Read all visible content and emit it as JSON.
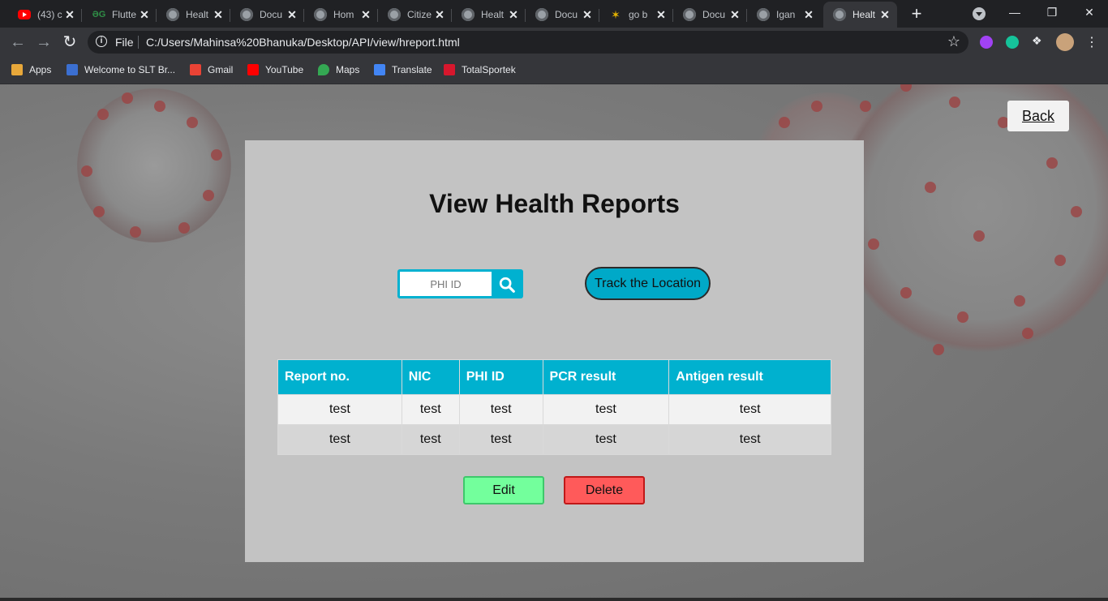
{
  "browser": {
    "tabs": [
      {
        "title": "(43) c",
        "icon": "youtube-icon",
        "active": false
      },
      {
        "title": "Flutte",
        "icon": "geeksforgeeks-icon",
        "active": false
      },
      {
        "title": "Healt",
        "icon": "globe-icon",
        "active": false
      },
      {
        "title": "Docu",
        "icon": "globe-icon",
        "active": false
      },
      {
        "title": "Hom",
        "icon": "globe-icon",
        "active": false
      },
      {
        "title": "Citize",
        "icon": "globe-icon",
        "active": false
      },
      {
        "title": "Healt",
        "icon": "globe-icon",
        "active": false
      },
      {
        "title": "Docu",
        "icon": "globe-icon",
        "active": false
      },
      {
        "title": "go b",
        "icon": "spark-icon",
        "active": false
      },
      {
        "title": "Docu",
        "icon": "globe-icon",
        "active": false
      },
      {
        "title": "Igan",
        "icon": "globe-icon",
        "active": false
      },
      {
        "title": "Healt",
        "icon": "globe-icon",
        "active": true
      }
    ],
    "new_tab_symbol": "+",
    "address": {
      "scheme_label": "File",
      "url": "C:/Users/Mahinsa%20Bhanuka/Desktop/API/view/hreport.html"
    },
    "bookmarks": [
      {
        "label": "Apps",
        "icon": "apps-grid-icon"
      },
      {
        "label": "Welcome to SLT Br...",
        "icon": "slt-icon"
      },
      {
        "label": "Gmail",
        "icon": "gmail-icon"
      },
      {
        "label": "YouTube",
        "icon": "youtube-icon"
      },
      {
        "label": "Maps",
        "icon": "maps-pin-icon"
      },
      {
        "label": "Translate",
        "icon": "translate-icon"
      },
      {
        "label": "TotalSportek",
        "icon": "ts-icon"
      }
    ]
  },
  "page": {
    "back_label": "Back",
    "title": "View Health Reports",
    "search": {
      "placeholder": "PHI ID",
      "value": ""
    },
    "track_button": "Track the Location",
    "table": {
      "headers": [
        "Report no.",
        "NIC",
        "PHI ID",
        "PCR result",
        "Antigen result"
      ],
      "rows": [
        [
          "test",
          "test",
          "test",
          "test",
          "test"
        ],
        [
          "test",
          "test",
          "test",
          "test",
          "test"
        ]
      ]
    },
    "edit_label": "Edit",
    "delete_label": "Delete"
  },
  "colors": {
    "accent": "#00b1cf",
    "edit": "#73ff9c",
    "delete": "#ff5a5a",
    "panel": "#c3c3c3"
  }
}
